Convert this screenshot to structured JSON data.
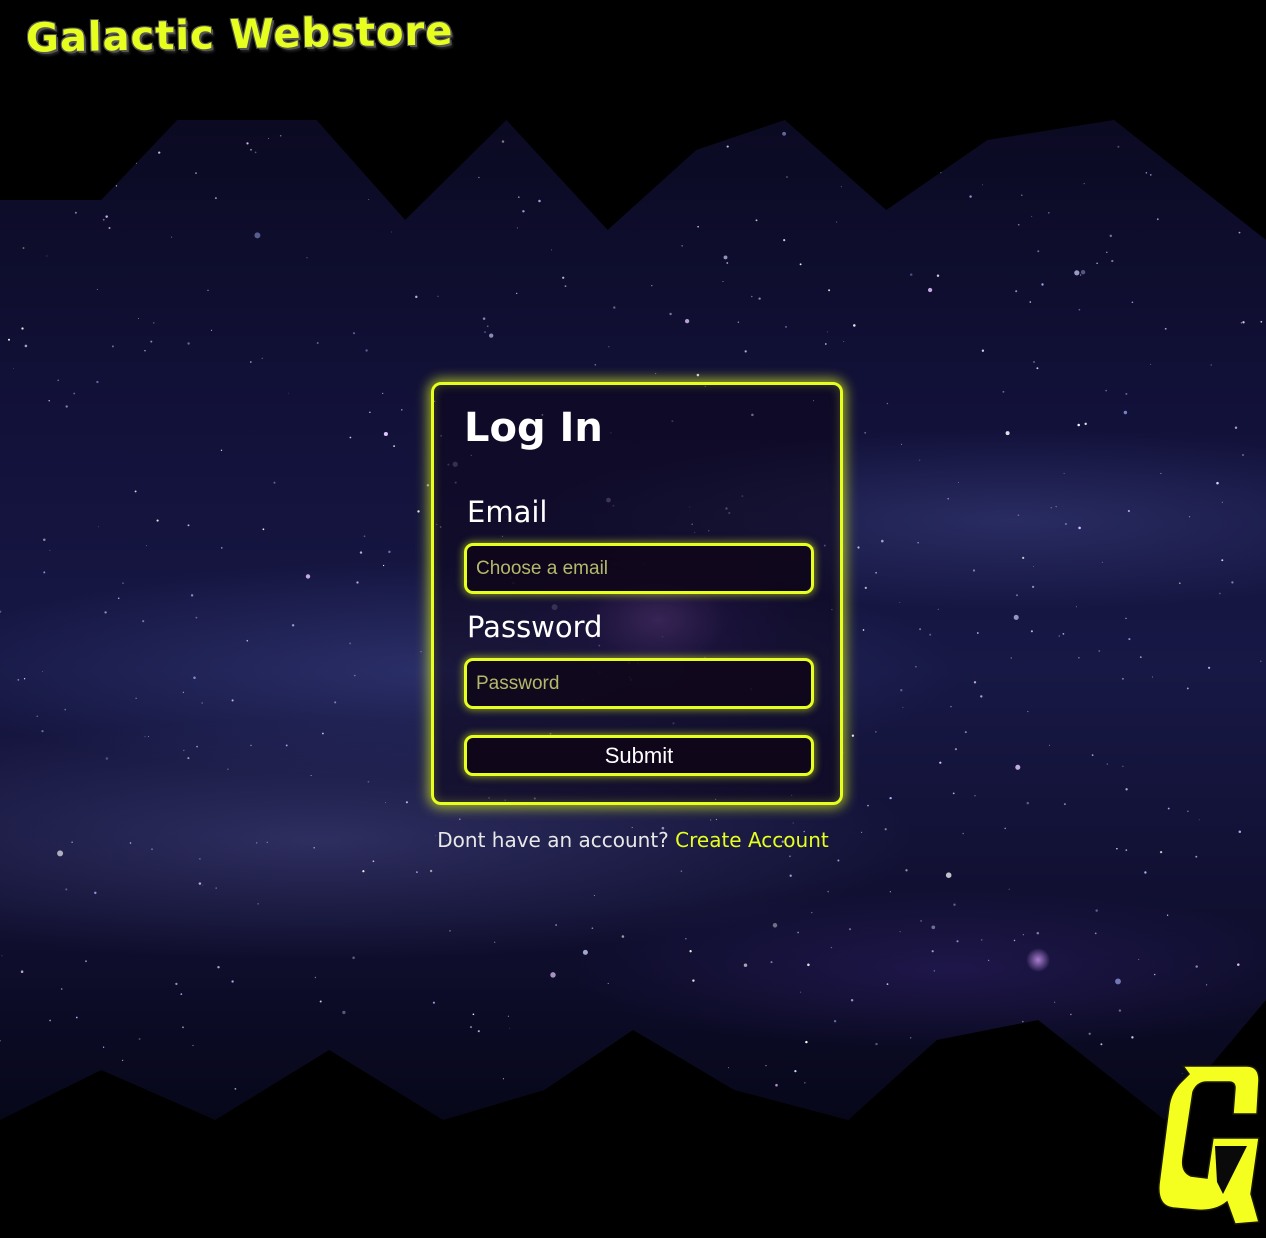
{
  "header": {
    "title": "Galactic Webstore"
  },
  "login": {
    "title": "Log In",
    "email_label": "Email",
    "email_placeholder": "Choose a email",
    "email_value": "",
    "password_label": "Password",
    "password_placeholder": "Password",
    "password_value": "",
    "submit_label": "Submit"
  },
  "signup": {
    "prompt": "Dont have an account?",
    "link_label": "Create Account"
  },
  "corner_logo": {
    "icon": "g-bolt-logo-icon",
    "letter": "G"
  },
  "colors": {
    "accent": "#e6ff1f",
    "background": "#000000",
    "text": "#ffffff"
  }
}
